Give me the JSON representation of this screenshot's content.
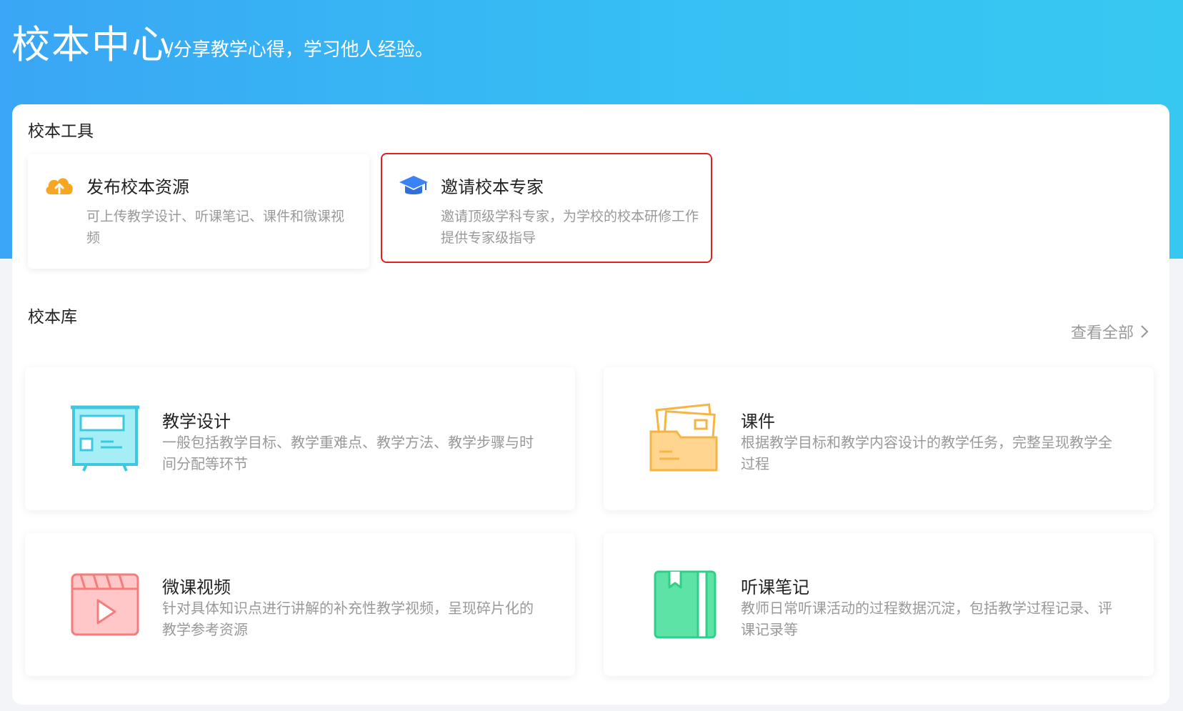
{
  "header": {
    "title": "校本中心",
    "subtitle": "/分享教学心得，学习他人经验。"
  },
  "tools": {
    "section_title": "校本工具",
    "items": [
      {
        "name": "发布校本资源",
        "desc": "可上传教学设计、听课笔记、课件和微课视频",
        "icon": "cloud-upload-icon",
        "color": "#f5a623"
      },
      {
        "name": "邀请校本专家",
        "desc": "邀请顶级学科专家，为学校的校本研修工作提供专家级指导",
        "icon": "graduation-cap-icon",
        "color": "#3b82f6",
        "selected": true
      }
    ]
  },
  "library": {
    "section_title": "校本库",
    "view_all": "查看全部",
    "items": [
      {
        "name": "教学设计",
        "desc": "一般包括教学目标、教学重难点、教学方法、教学步骤与时间分配等环节",
        "icon": "presentation-board-icon",
        "color": "#3cc9e0"
      },
      {
        "name": "课件",
        "desc": "根据教学目标和教学内容设计的教学任务，完整呈现教学全过程",
        "icon": "folder-icon",
        "color": "#f5b544"
      },
      {
        "name": "微课视频",
        "desc": "针对具体知识点进行讲解的补充性教学视频，呈现碎片化的教学参考资源",
        "icon": "video-play-icon",
        "color": "#f47c7c"
      },
      {
        "name": "听课笔记",
        "desc": "教师日常听课活动的过程数据沉淀，包括教学过程记录、评课记录等",
        "icon": "notebook-icon",
        "color": "#2fcf8a"
      }
    ]
  }
}
